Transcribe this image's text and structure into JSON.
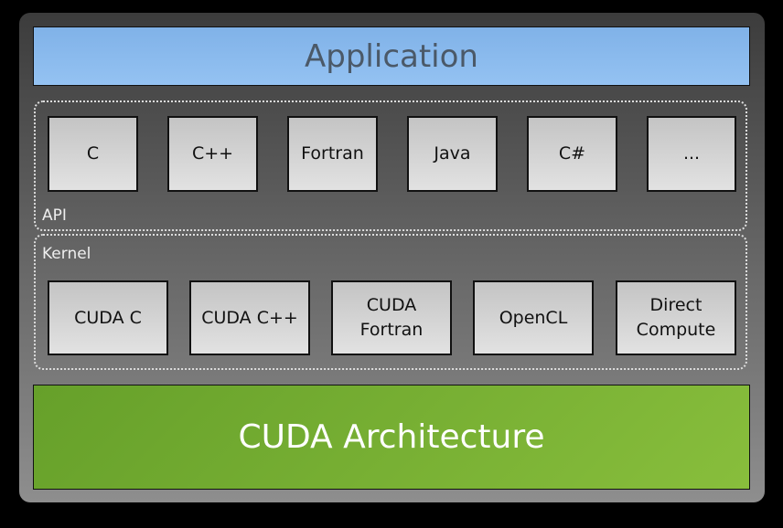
{
  "application": "Application",
  "api": {
    "label": "API",
    "items": [
      "C",
      "C++",
      "Fortran",
      "Java",
      "C#",
      "..."
    ]
  },
  "kernel": {
    "label": "Kernel",
    "items": [
      "CUDA C",
      "CUDA C++",
      "CUDA Fortran",
      "OpenCL",
      "Direct Compute"
    ]
  },
  "architecture": "CUDA Architecture",
  "colors": {
    "application": "#8ab8ea",
    "architecture": "#76b030",
    "box": "#d4d4d4"
  }
}
